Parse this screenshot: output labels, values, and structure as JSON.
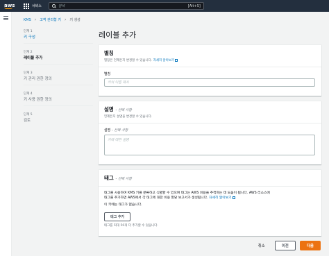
{
  "topnav": {
    "logo": "aws",
    "services_label": "서비스",
    "search_placeholder": "검색",
    "search_shortcut": "[Alt+S]"
  },
  "breadcrumb": [
    "KMS",
    "고객 관리형 키",
    "키 생성"
  ],
  "steps": [
    {
      "num": "단계 1",
      "name": "키 구성"
    },
    {
      "num": "단계 2",
      "name": "레이블 추가"
    },
    {
      "num": "단계 3",
      "name": "키 관리 권한 정의"
    },
    {
      "num": "단계 4",
      "name": "키 사용 권한 정의"
    },
    {
      "num": "단계 5",
      "name": "검토"
    }
  ],
  "page_title": "레이블 추가",
  "alias": {
    "title": "별칭",
    "desc": "별칭은 언제든지 변경할 수 있습니다.",
    "learn_more": "자세히 알아보기",
    "field_label": "별칭",
    "placeholder": "키의 이름 제시"
  },
  "description": {
    "title": "설명",
    "optional": "- 선택 사항",
    "desc": "언제든지 설명을 변경할 수 있습니다.",
    "field_label": "설명",
    "field_optional": "- 선택 사항",
    "placeholder": "키에 대한 설명"
  },
  "tags": {
    "title": "태그",
    "optional": "- 선택 사항",
    "desc_line1": "태그를 사용하여 KMS 키를 분류하고 식별할 수 있으며 태그는 AWS 비용을 추적하는 데 도움이 됩니다. AWS 리소스에",
    "desc_line2": "태그를 추가하면 AWS에서 각 태그에 대한 비용 할당 보고서가 생성됩니다.",
    "learn_more": "자세히 알아보기",
    "empty": "이 키에는 태그가 없습니다.",
    "add_button": "태그 추가",
    "limit": "태그를 최대 50개 더 추가할 수 있습니다."
  },
  "footer": {
    "cancel": "취소",
    "previous": "이전",
    "next": "다음"
  },
  "colors": {
    "nav_bg": "#232f3e",
    "link": "#0073bb",
    "primary": "#ec7211"
  }
}
